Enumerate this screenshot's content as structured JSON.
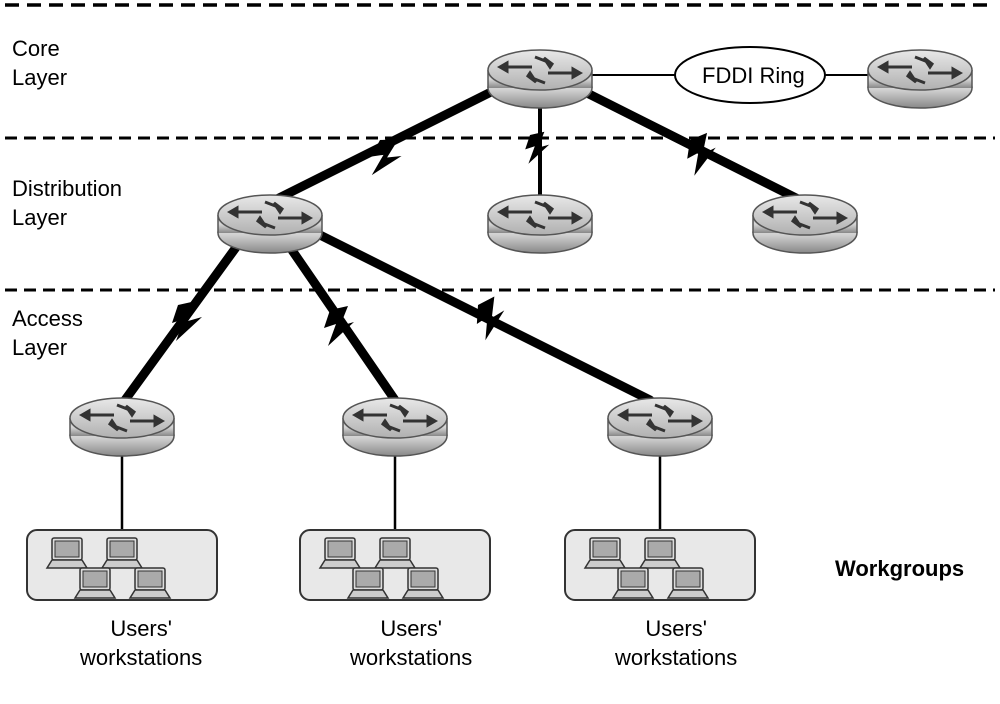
{
  "layers": {
    "core": "Core\nLayer",
    "distribution": "Distribution\nLayer",
    "access": "Access\nLayer"
  },
  "fddi": "FDDI Ring",
  "workgroups_label": "Workgroups",
  "workstations_label": "Users'\nworkstations",
  "chart_data": {
    "type": "diagram",
    "title": "Three-Layer Hierarchical Network Model",
    "layers": [
      {
        "name": "Core Layer",
        "devices": [
          "Core Router 1",
          "Core Router 2"
        ],
        "connection": "FDDI Ring"
      },
      {
        "name": "Distribution Layer",
        "devices": [
          "Dist Router 1",
          "Dist Router 2",
          "Dist Router 3"
        ]
      },
      {
        "name": "Access Layer",
        "devices": [
          "Access Router 1",
          "Access Router 2",
          "Access Router 3"
        ],
        "endpoints": "Users' workstations (Workgroups)"
      }
    ],
    "links": [
      {
        "from": "Core Router 1",
        "to": "Core Router 2",
        "via": "FDDI Ring"
      },
      {
        "from": "Core Router 1",
        "to": "Dist Router 1",
        "type": "serial"
      },
      {
        "from": "Core Router 1",
        "to": "Dist Router 2",
        "type": "serial"
      },
      {
        "from": "Core Router 1",
        "to": "Dist Router 3",
        "type": "serial"
      },
      {
        "from": "Dist Router 1",
        "to": "Access Router 1",
        "type": "serial"
      },
      {
        "from": "Dist Router 1",
        "to": "Access Router 2",
        "type": "serial"
      },
      {
        "from": "Dist Router 1",
        "to": "Access Router 3",
        "type": "serial"
      },
      {
        "from": "Access Router 1",
        "to": "Workgroup 1",
        "type": "ethernet"
      },
      {
        "from": "Access Router 2",
        "to": "Workgroup 2",
        "type": "ethernet"
      },
      {
        "from": "Access Router 3",
        "to": "Workgroup 3",
        "type": "ethernet"
      }
    ]
  }
}
